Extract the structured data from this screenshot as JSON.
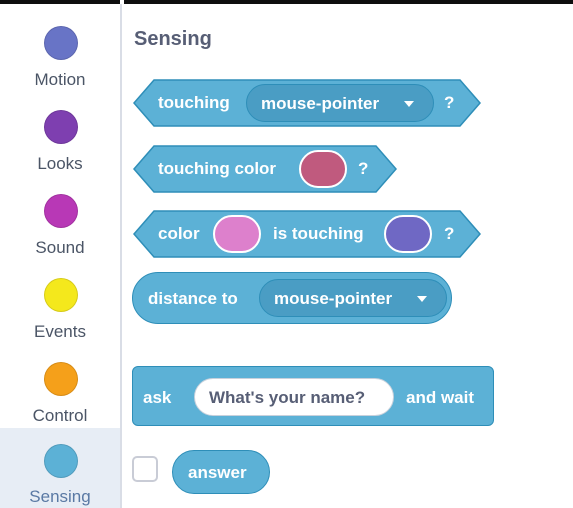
{
  "sidebar": {
    "categories": [
      {
        "label": "Motion",
        "color": "#6874c6"
      },
      {
        "label": "Looks",
        "color": "#7e3fb0"
      },
      {
        "label": "Sound",
        "color": "#b838b6"
      },
      {
        "label": "Events",
        "color": "#f4e81c"
      },
      {
        "label": "Control",
        "color": "#f5a01a"
      },
      {
        "label": "Sensing",
        "color": "#5cb1d6",
        "selected": true
      }
    ]
  },
  "palette": {
    "heading": "Sensing",
    "blocks": {
      "touching": {
        "label": "touching",
        "menu": "mouse-pointer",
        "suffix": "?"
      },
      "touching_color": {
        "label": "touching color",
        "swatch": "#c05a7e",
        "suffix": "?"
      },
      "color_touching": {
        "label1": "color",
        "swatch1": "#dd80cc",
        "label2": "is touching",
        "swatch2": "#6f68c4",
        "suffix": "?"
      },
      "distance": {
        "label": "distance to",
        "menu": "mouse-pointer"
      },
      "ask": {
        "label": "ask",
        "input": "What's your name?",
        "suffix": "and wait"
      },
      "answer": {
        "label": "answer"
      }
    }
  },
  "colors": {
    "block_fill": "#5cb1d6",
    "block_border": "#2e8eb8",
    "heading_text": "#575e75"
  }
}
